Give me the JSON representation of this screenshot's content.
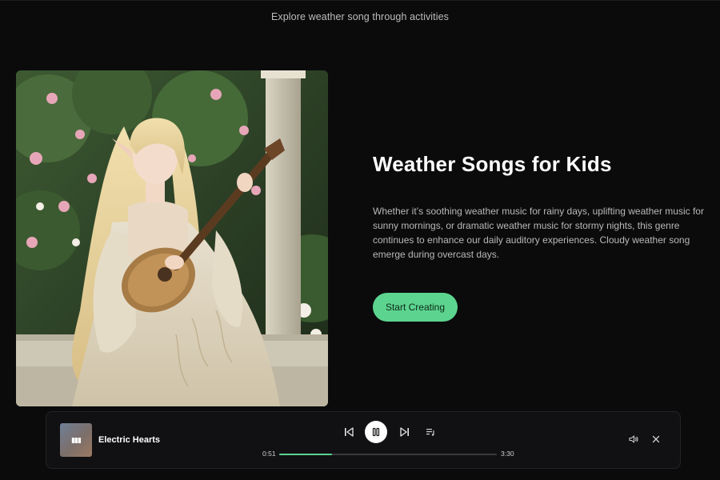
{
  "header": {
    "subtitle": "Explore weather song through activities"
  },
  "hero": {
    "title": "Weather Songs for Kids",
    "description": "Whether it’s soothing weather music for rainy days, uplifting weather music for sunny mornings, or dramatic weather music for stormy nights, this genre continues to enhance our daily auditory experiences. Cloudy weather song emerge during overcast days.",
    "cta_label": "Start Creating",
    "image_icon": "illustration-elf-playing-lute"
  },
  "player": {
    "track_title": "Electric Hearts",
    "current_time": "0:51",
    "total_time": "3:30",
    "progress": 0.243,
    "icons": {
      "prev": "skip-previous-icon",
      "play": "pause-icon",
      "next": "skip-next-icon",
      "queue": "playlist-icon",
      "volume": "volume-icon",
      "close": "close-icon"
    }
  },
  "colors": {
    "background": "#0b0b0c",
    "accent": "#5cd48f",
    "player_bg": "#111113"
  }
}
